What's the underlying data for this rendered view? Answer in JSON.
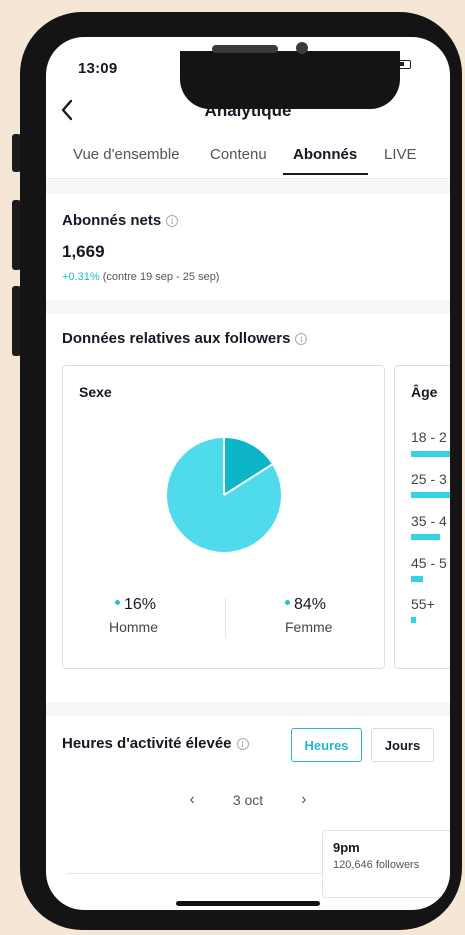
{
  "status_bar": {
    "time": "13:09"
  },
  "header": {
    "back_icon": "chevron-left-icon",
    "title": "Analytique"
  },
  "tabs": [
    {
      "label": "Vue d'ensemble",
      "active": false
    },
    {
      "label": "Contenu",
      "active": false
    },
    {
      "label": "Abonnés",
      "active": true
    },
    {
      "label": "LIVE",
      "active": false
    }
  ],
  "net_followers": {
    "title": "Abonnés nets",
    "value": "1,669",
    "change": "+0.31%",
    "comparison": "(contre 19 sep - 25 sep)"
  },
  "follower_data": {
    "title": "Données relatives aux followers",
    "gender": {
      "title": "Sexe",
      "male": {
        "pct": "16%",
        "label": "Homme",
        "value": 16
      },
      "female": {
        "pct": "84%",
        "label": "Femme",
        "value": 84
      }
    },
    "age": {
      "title": "Âge",
      "groups": [
        {
          "label": "18 - 2",
          "share": 0.63
        },
        {
          "label": "25 - 3",
          "share": 0.52
        },
        {
          "label": "35 - 4",
          "share": 0.29
        },
        {
          "label": "45 - 5",
          "share": 0.12
        },
        {
          "label": "55+",
          "share": 0.05
        }
      ]
    }
  },
  "activity": {
    "title": "Heures d'activité élevée",
    "hours_button": "Heures",
    "days_button": "Jours",
    "date": "3 oct",
    "tooltip": {
      "hour": "9pm",
      "followers": "120,646 followers"
    }
  },
  "colors": {
    "accent": "#20b8c7",
    "pie_male": "#0eb5c9",
    "pie_female": "#4fdbec"
  }
}
